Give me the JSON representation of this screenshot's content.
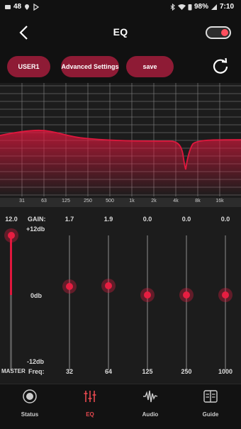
{
  "status": {
    "notif_count": "48",
    "battery": "98%",
    "time": "7:10"
  },
  "header": {
    "title": "EQ",
    "toggle_on": true
  },
  "presets": {
    "user": "USER1",
    "advanced": "Advanced Settings",
    "save": "save"
  },
  "graph": {
    "freq_labels": [
      "31",
      "63",
      "125",
      "250",
      "500",
      "1k",
      "2k",
      "4k",
      "8k",
      "16k"
    ],
    "curve_color": "#e0173d"
  },
  "eq": {
    "master_value": "12.0",
    "gain_label": "GAIN:",
    "max_label": "+12db",
    "zero_label": "0db",
    "min_label": "-12db",
    "master_label": "MASTER",
    "freq_label": "Freq:",
    "bands": [
      {
        "value": "1.7",
        "freq": "32"
      },
      {
        "value": "1.9",
        "freq": "64"
      },
      {
        "value": "0.0",
        "freq": "125"
      },
      {
        "value": "0.0",
        "freq": "250"
      },
      {
        "value": "0.0",
        "freq": "1000"
      }
    ]
  },
  "nav": [
    {
      "label": "Status",
      "icon": "status-icon",
      "active": false
    },
    {
      "label": "EQ",
      "icon": "eq-icon",
      "active": true
    },
    {
      "label": "Audio",
      "icon": "audio-icon",
      "active": false
    },
    {
      "label": "Guide",
      "icon": "guide-icon",
      "active": false
    }
  ],
  "colors": {
    "accent": "#e0173d",
    "pill": "#8e1b35",
    "nav_active": "#e6484f"
  }
}
